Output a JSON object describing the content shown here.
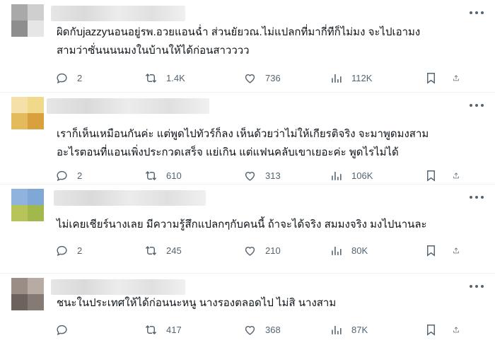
{
  "icons": {
    "reply": "reply-icon",
    "repost": "repost-icon",
    "like": "heart-icon",
    "views": "views-icon",
    "bookmark": "bookmark-icon",
    "share": "share-icon",
    "more": "more-icon"
  },
  "colors": {
    "text": "#0f1419",
    "muted": "#536471",
    "divider": "#eff3f4"
  },
  "posts": [
    {
      "text_lines": [
        "ผิดกับjazzyนอนอยู่รพ.อวยแอนฉ่ำ ส่วนยัยวณ.ไม่แปลกที่มากี่ทีก็ไม่มง จะไปเอามง",
        "สามว่าซั่นนนนมงในบ้านให้ได้ก่อนสาวววว"
      ],
      "replies": "2",
      "reposts": "1.4K",
      "likes": "736",
      "views": "112K"
    },
    {
      "text_lines": [
        "เราก็เห็นเหมือนกันค่ะ แต่พูดไปทัวร์ก็ลง เห็นด้วยว่าไม่ให้เกียรติจริง จะมาพูดมงสาม",
        "อะไรตอนที่แอนเพิ่งประกวดเสร็จ แย่เกิน แต่แฟนคลับเขาเยอะค่ะ พูดไรไม่ได้"
      ],
      "replies": "2",
      "reposts": "610",
      "likes": "313",
      "views": "106K"
    },
    {
      "text_lines": [
        "ไม่เคยเชียร์นางเลย มีความรู้สึกแปลกๆกับคนนี้ ถ้าจะได้จริง สมมงจริง มงไปนานละ"
      ],
      "replies": "2",
      "reposts": "245",
      "likes": "210",
      "views": "80K"
    },
    {
      "text_lines": [
        "ชนะในประเทศให้ได้ก่อนนะหนู นางรองตลอดไป ไม่สิ นางสาม"
      ],
      "replies": "",
      "reposts": "417",
      "likes": "368",
      "views": "87K"
    }
  ]
}
